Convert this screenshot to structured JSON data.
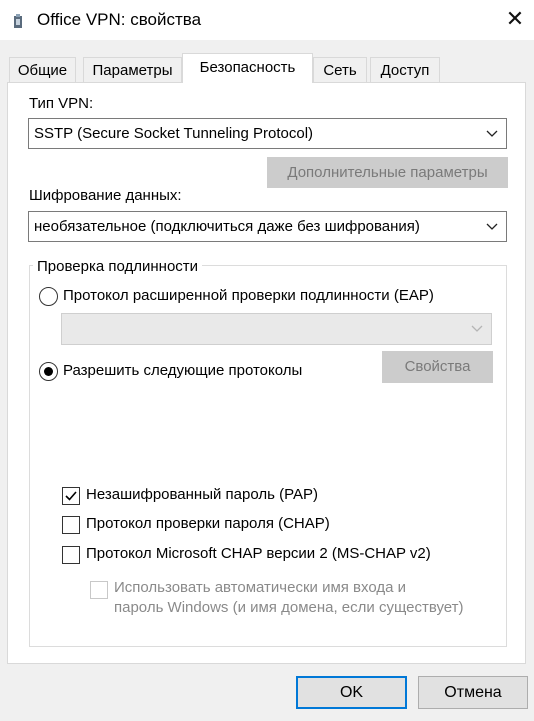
{
  "window": {
    "title": "Office VPN: свойства",
    "close_glyph": "✕"
  },
  "tabs": [
    {
      "label": "Общие"
    },
    {
      "label": "Параметры"
    },
    {
      "label": "Безопасность"
    },
    {
      "label": "Сеть"
    },
    {
      "label": "Доступ"
    }
  ],
  "active_tab": "Безопасность",
  "vpn_type": {
    "label": "Тип VPN:",
    "value": "SSTP (Secure Socket Tunneling Protocol)"
  },
  "advanced_button": "Дополнительные параметры",
  "encryption": {
    "label": "Шифрование данных:",
    "value": "необязательное (подключиться даже без шифрования)"
  },
  "auth": {
    "title": "Проверка подлинности",
    "eap_label": "Протокол расширенной проверки подлинности (EAP)",
    "eap_selected": false,
    "eap_combo_value": "",
    "allow_label": "Разрешить следующие протоколы",
    "allow_selected": true,
    "properties_button": "Свойства",
    "protocols": [
      {
        "label": "Незашифрованный пароль (PAP)",
        "checked": true
      },
      {
        "label": "Протокол проверки пароля (CHAP)",
        "checked": false
      },
      {
        "label": "Протокол Microsoft CHAP версии 2 (MS-CHAP v2)",
        "checked": false
      }
    ],
    "auto_logon_line1": "Использовать автоматически имя входа и",
    "auto_logon_line2": "пароль Windows (и имя домена, если существует)",
    "auto_logon_checked": false
  },
  "footer": {
    "ok": "OK",
    "cancel": "Отмена"
  },
  "colors": {
    "accent": "#0078d7",
    "window_bg": "#f0f0f0",
    "panel_bg": "#ffffff"
  }
}
